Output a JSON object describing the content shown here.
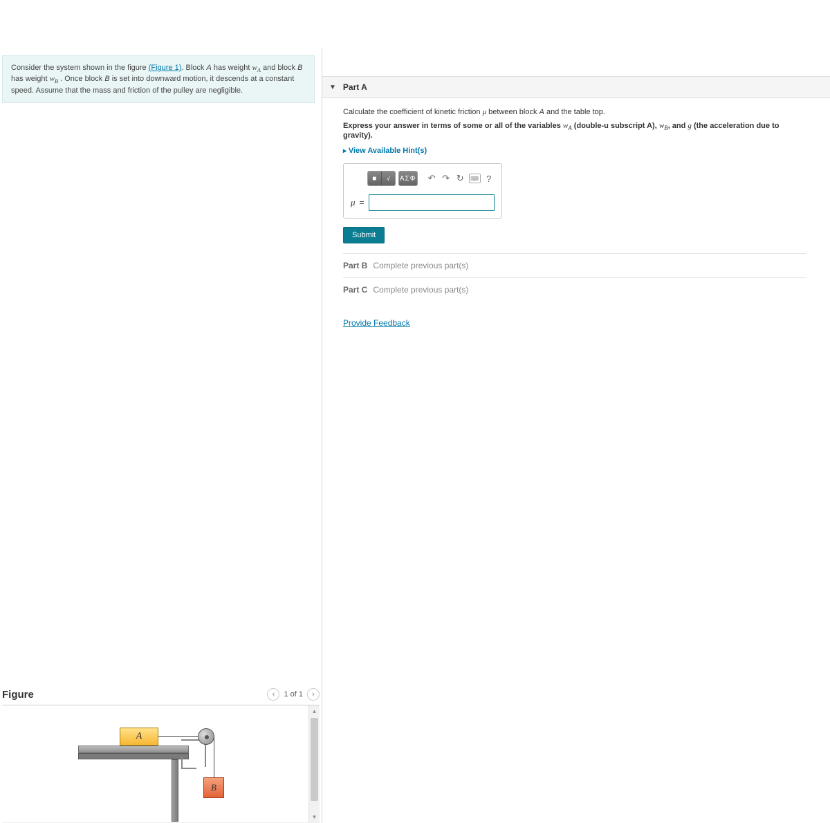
{
  "close_icon": "✕",
  "prompt": {
    "pre": "Consider the system shown in the figure ",
    "figlink": "(Figure 1)",
    "mid1": ". Block ",
    "A": "A",
    "mid2": " has weight ",
    "wA": "w",
    "wA_sub": "A",
    "mid3": " and block ",
    "B": "B",
    "mid4": " has weight ",
    "wB": "w",
    "wB_sub": "B",
    "mid5": " . Once block ",
    "B2": "B",
    "tail": " is set into downward motion, it descends at a constant speed. Assume that the mass and friction of the pulley are negligible."
  },
  "figure": {
    "title": "Figure",
    "pager": "1 of 1",
    "labelA": "A",
    "labelB": "B"
  },
  "partA": {
    "header": "Part A",
    "q_pre": "Calculate the coefficient of kinetic friction ",
    "q_mu": "μ",
    "q_mid": " between block ",
    "q_A": "A",
    "q_tail": " and the table top.",
    "express_pre": "Express your answer in terms of some or all of the variables ",
    "exp_wA": "w",
    "exp_wA_sub": "A",
    "exp_paren": " (double-u subscript A), ",
    "exp_wB": "w",
    "exp_wB_sub": "B",
    "exp_and": ", and ",
    "exp_g": "g",
    "exp_tail": " (the acceleration due to gravity).",
    "hints": "View Available Hint(s)",
    "toolbar": {
      "tmpl": "■",
      "root": "√",
      "greek": "ΑΣΦ",
      "undo": "↶",
      "redo": "↷",
      "reset": "↻",
      "keyboard": "⌨",
      "help": "?"
    },
    "mu_label": "μ",
    "eq": "=",
    "submit": "Submit"
  },
  "partB": {
    "label": "Part B",
    "msg": "Complete previous part(s)"
  },
  "partC": {
    "label": "Part C",
    "msg": "Complete previous part(s)"
  },
  "feedback": "Provide Feedback"
}
